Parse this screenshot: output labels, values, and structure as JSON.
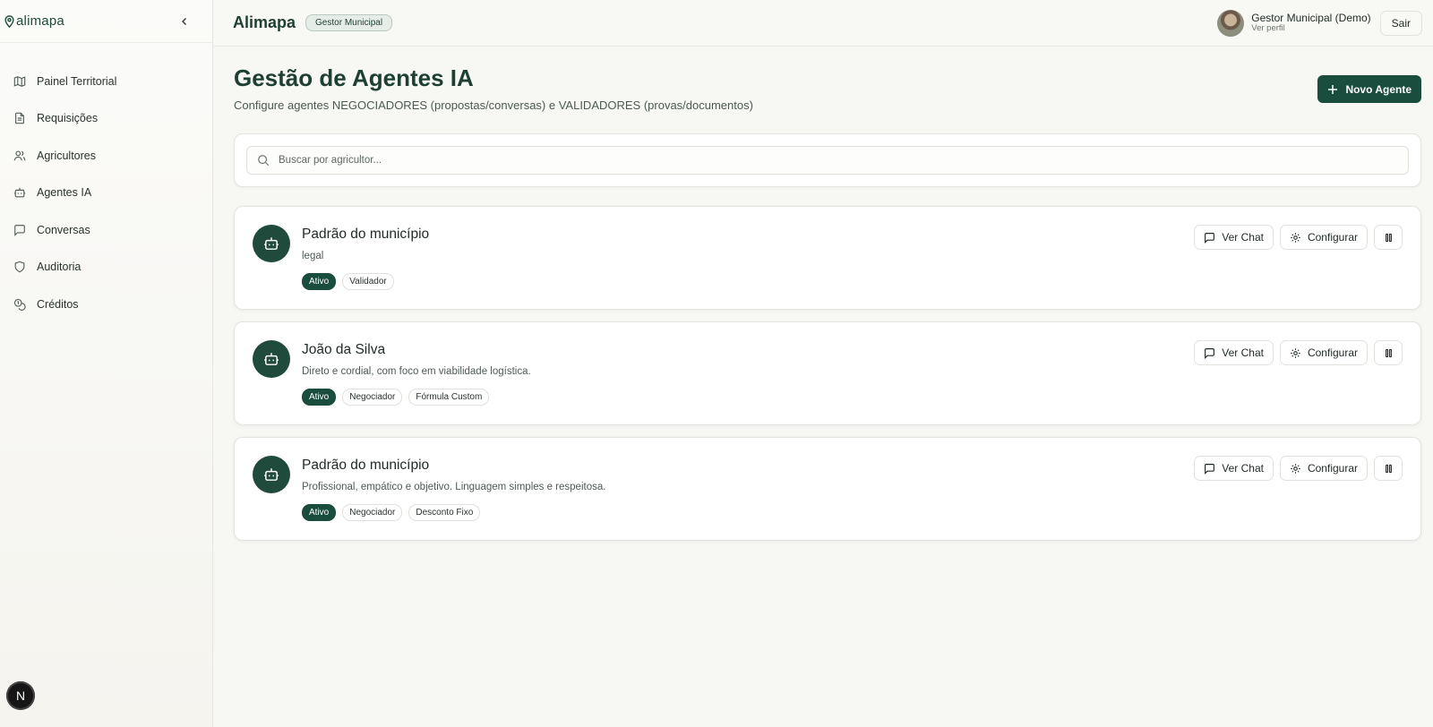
{
  "sidebar": {
    "logo_text": "alimapa",
    "items": [
      {
        "label": "Painel Territorial",
        "icon": "map-icon"
      },
      {
        "label": "Requisições",
        "icon": "file-text-icon"
      },
      {
        "label": "Agricultores",
        "icon": "users-icon"
      },
      {
        "label": "Agentes IA",
        "icon": "bot-icon"
      },
      {
        "label": "Conversas",
        "icon": "message-square-icon"
      },
      {
        "label": "Auditoria",
        "icon": "shield-icon"
      },
      {
        "label": "Créditos",
        "icon": "coins-icon"
      }
    ],
    "bottom_badge": "N"
  },
  "header": {
    "brand": "Alimapa",
    "role_badge": "Gestor Municipal",
    "user_name": "Gestor Municipal (Demo)",
    "user_link": "Ver perfil",
    "logout_label": "Sair"
  },
  "main": {
    "title": "Gestão de Agentes IA",
    "subtitle": "Configure agentes NEGOCIADORES (propostas/conversas) e VALIDADORES (provas/documentos)",
    "new_agent_label": "Novo Agente",
    "search_placeholder": "Buscar por agricultor...",
    "agents": [
      {
        "name": "Padrão do município",
        "description": "legal",
        "tags": [
          "Ativo",
          "Validador"
        ]
      },
      {
        "name": "João da Silva",
        "description": "Direto e cordial, com foco em viabilidade logística.",
        "tags": [
          "Ativo",
          "Negociador",
          "Fórmula Custom"
        ]
      },
      {
        "name": "Padrão do município",
        "description": "Profissional, empático e objetivo. Linguagem simples e respeitosa.",
        "tags": [
          "Ativo",
          "Negociador",
          "Desconto Fixo"
        ]
      }
    ],
    "actions": {
      "chat_label": "Ver Chat",
      "configure_label": "Configurar"
    }
  },
  "colors": {
    "primary": "#1b4d3e",
    "background": "#f7f7f4",
    "card": "#ffffff"
  }
}
